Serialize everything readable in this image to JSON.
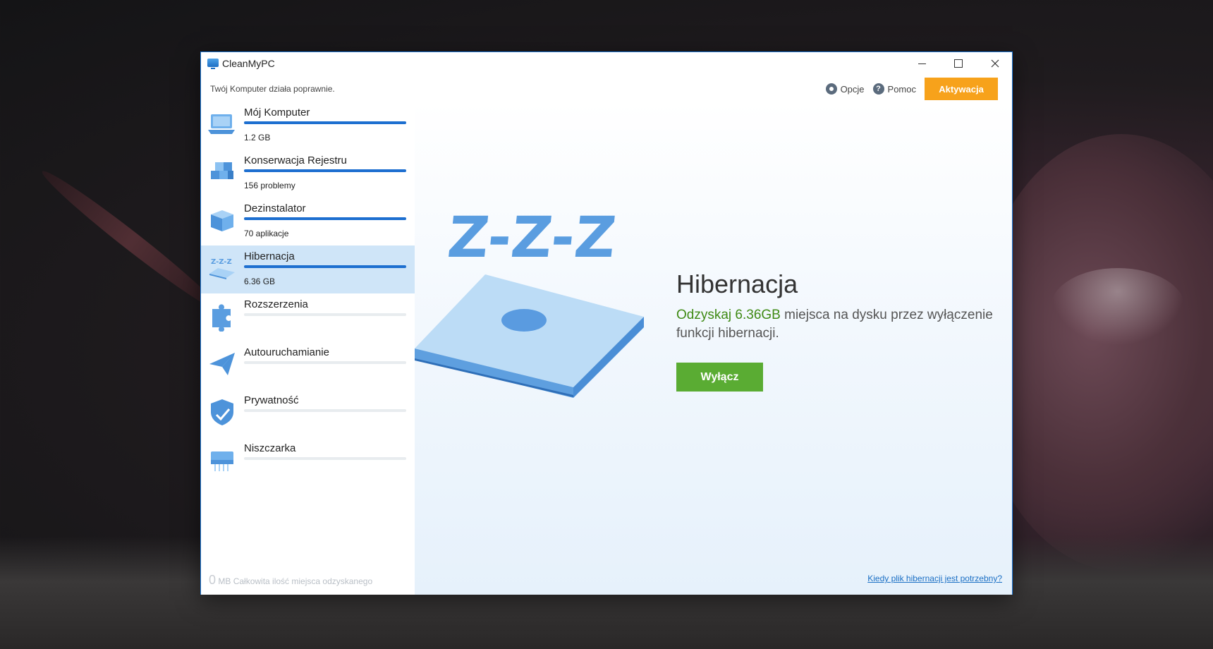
{
  "window": {
    "title": "CleanMyPC",
    "status": "Twój Komputer działa poprawnie."
  },
  "header": {
    "options_label": "Opcje",
    "help_label": "Pomoc",
    "help_glyph": "?",
    "activate_label": "Aktywacja",
    "accent_color": "#f7a21b"
  },
  "sidebar": {
    "items": [
      {
        "label": "Mój Komputer",
        "value": "1.2 GB",
        "progress": 1.0,
        "icon": "laptop-icon"
      },
      {
        "label": "Konserwacja Rejestru",
        "value": "156 problemy",
        "progress": 1.0,
        "icon": "registry-cubes-icon"
      },
      {
        "label": "Dezinstalator",
        "value": "70 aplikacje",
        "progress": 1.0,
        "icon": "uninstaller-box-icon"
      },
      {
        "label": "Hibernacja",
        "value": "6.36 GB",
        "progress": 1.0,
        "icon": "hibernation-icon",
        "active": true
      },
      {
        "label": "Rozszerzenia",
        "value": "",
        "progress": 0,
        "icon": "puzzle-icon"
      },
      {
        "label": "Autouruchamianie",
        "value": "",
        "progress": 0,
        "icon": "paper-plane-icon"
      },
      {
        "label": "Prywatność",
        "value": "",
        "progress": 0,
        "icon": "shield-icon"
      },
      {
        "label": "Niszczarka",
        "value": "",
        "progress": 0,
        "icon": "shredder-icon"
      }
    ],
    "footer_number": "0",
    "footer_text": "MB Całkowita ilość miejsca odzyskanego"
  },
  "main": {
    "illustration_text": "Z-Z-Z",
    "title": "Hibernacja",
    "desc_accent": "Odzyskaj 6.36GB",
    "desc_rest": " miejsca na dysku przez wyłączenie funkcji hibernacji.",
    "button_label": "Wyłącz",
    "help_link": "Kiedy plik hibernacji jest potrzebny?",
    "button_color": "#5aac33",
    "accent_text_color": "#3f8a14"
  }
}
